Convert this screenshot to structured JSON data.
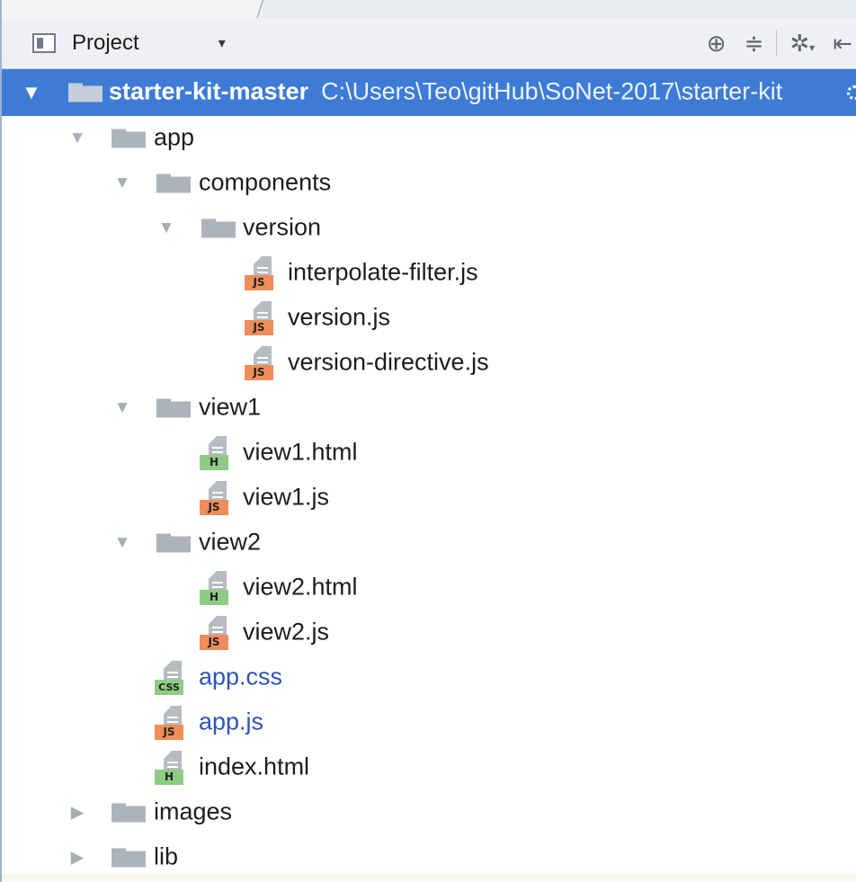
{
  "toolbar": {
    "title": "Project",
    "dropdown_glyph": "▾",
    "icons": [
      "project-icon",
      "locate-icon",
      "collapse-all-icon",
      "settings-icon",
      "hide-panel-icon"
    ]
  },
  "tree": {
    "root": {
      "name": "starter-kit-master",
      "path": "C:\\Users\\Teo\\gitHub\\SoNet-2017\\starter-kit"
    },
    "items": [
      {
        "label": "app",
        "type": "folder",
        "expanded": true
      },
      {
        "label": "components",
        "type": "folder",
        "expanded": true
      },
      {
        "label": "version",
        "type": "folder",
        "expanded": true
      },
      {
        "label": "interpolate-filter.js",
        "type": "file",
        "badge": "JS"
      },
      {
        "label": "version.js",
        "type": "file",
        "badge": "JS"
      },
      {
        "label": "version-directive.js",
        "type": "file",
        "badge": "JS"
      },
      {
        "label": "view1",
        "type": "folder",
        "expanded": true
      },
      {
        "label": "view1.html",
        "type": "file",
        "badge": "H"
      },
      {
        "label": "view1.js",
        "type": "file",
        "badge": "JS"
      },
      {
        "label": "view2",
        "type": "folder",
        "expanded": true
      },
      {
        "label": "view2.html",
        "type": "file",
        "badge": "H"
      },
      {
        "label": "view2.js",
        "type": "file",
        "badge": "JS"
      },
      {
        "label": "app.css",
        "type": "file",
        "badge": "CSS",
        "modified": true
      },
      {
        "label": "app.js",
        "type": "file",
        "badge": "JS",
        "modified": true
      },
      {
        "label": "index.html",
        "type": "file",
        "badge": "H"
      },
      {
        "label": "images",
        "type": "folder",
        "expanded": false
      },
      {
        "label": "lib",
        "type": "folder",
        "expanded": false
      }
    ]
  },
  "colors": {
    "selection": "#3d7bd6",
    "modified_text": "#2c55b8",
    "js_badge": "#f08d5a",
    "html_badge": "#8fcc83",
    "folder": "#adb3bb"
  }
}
